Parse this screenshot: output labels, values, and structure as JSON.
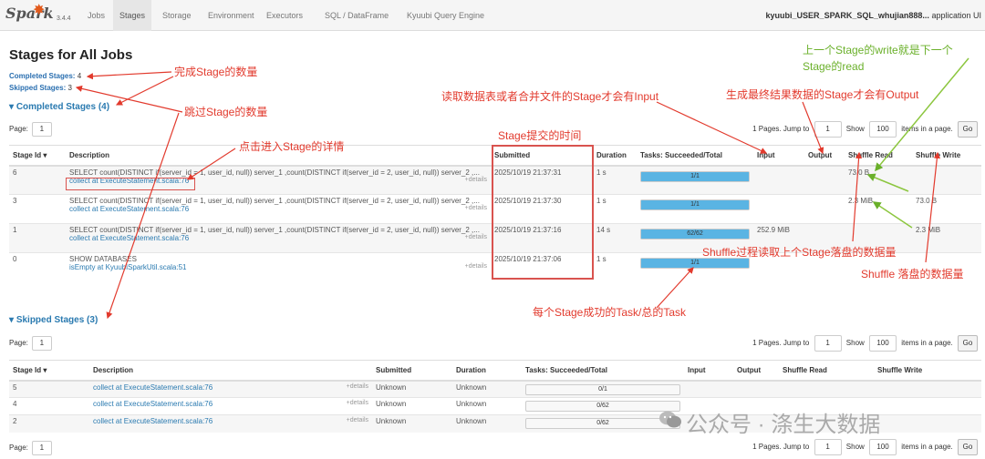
{
  "nav": {
    "logo": "Spark",
    "version": "3.4.4",
    "tabs": [
      "Jobs",
      "Stages",
      "Storage",
      "Environment",
      "Executors",
      "SQL / DataFrame",
      "Kyuubi Query Engine"
    ],
    "active_tab": "Stages",
    "app_name": "kyuubi_USER_SPARK_SQL_whujian888...",
    "app_suffix": "application UI"
  },
  "page_title": "Stages for All Jobs",
  "summary": {
    "completed_label": "Completed Stages:",
    "completed_count": "4",
    "skipped_label": "Skipped Stages:",
    "skipped_count": "3"
  },
  "completed_section": {
    "title": "Completed Stages (4)",
    "page_label": "Page:",
    "page_value": "1",
    "pager": {
      "pages_text": "1 Pages. Jump to",
      "jump_value": "1",
      "show_label": "Show",
      "show_value": "100",
      "items_text": "items in a page.",
      "go": "Go"
    },
    "columns": [
      "Stage Id ▾",
      "Description",
      "Submitted",
      "Duration",
      "Tasks: Succeeded/Total",
      "Input",
      "Output",
      "Shuffle Read",
      "Shuffle Write"
    ],
    "rows": [
      {
        "id": "6",
        "desc": "SELECT count(DISTINCT if(server_id = 1, user_id, null)) server_1 ,count(DISTINCT if(server_id = 2, user_id, null)) server_2 ,...",
        "link": "collect at ExecuteStatement.scala:76",
        "details": "+details",
        "submitted": "2025/10/19 21:37:31",
        "duration": "1 s",
        "tasks": "1/1",
        "progress": 1.0,
        "input": "",
        "output": "",
        "shuffle_read": "73.0 B",
        "shuffle_write": ""
      },
      {
        "id": "3",
        "desc": "SELECT count(DISTINCT if(server_id = 1, user_id, null)) server_1 ,count(DISTINCT if(server_id = 2, user_id, null)) server_2 ,...",
        "link": "collect at ExecuteStatement.scala:76",
        "details": "+details",
        "submitted": "2025/10/19 21:37:30",
        "duration": "1 s",
        "tasks": "1/1",
        "progress": 1.0,
        "input": "",
        "output": "",
        "shuffle_read": "2.3 MiB",
        "shuffle_write": "73.0 B"
      },
      {
        "id": "1",
        "desc": "SELECT count(DISTINCT if(server_id = 1, user_id, null)) server_1 ,count(DISTINCT if(server_id = 2, user_id, null)) server_2 ,...",
        "link": "collect at ExecuteStatement.scala:76",
        "details": "+details",
        "submitted": "2025/10/19 21:37:16",
        "duration": "14 s",
        "tasks": "62/62",
        "progress": 1.0,
        "input": "252.9 MiB",
        "output": "",
        "shuffle_read": "",
        "shuffle_write": "2.3 MiB"
      },
      {
        "id": "0",
        "desc": "SHOW DATABASES",
        "link": "isEmpty at KyuubiSparkUtil.scala:51",
        "details": "+details",
        "submitted": "2025/10/19 21:37:06",
        "duration": "1 s",
        "tasks": "1/1",
        "progress": 1.0,
        "input": "",
        "output": "",
        "shuffle_read": "",
        "shuffle_write": ""
      }
    ]
  },
  "skipped_section": {
    "title": "Skipped Stages (3)",
    "page_label": "Page:",
    "page_value": "1",
    "pager": {
      "pages_text": "1 Pages. Jump to",
      "jump_value": "1",
      "show_label": "Show",
      "show_value": "100",
      "items_text": "items in a page.",
      "go": "Go"
    },
    "columns": [
      "Stage Id ▾",
      "Description",
      "Submitted",
      "Duration",
      "Tasks: Succeeded/Total",
      "Input",
      "Output",
      "Shuffle Read",
      "Shuffle Write"
    ],
    "rows": [
      {
        "id": "5",
        "link": "collect at ExecuteStatement.scala:76",
        "details": "+details",
        "submitted": "Unknown",
        "duration": "Unknown",
        "tasks": "0/1"
      },
      {
        "id": "4",
        "link": "collect at ExecuteStatement.scala:76",
        "details": "+details",
        "submitted": "Unknown",
        "duration": "Unknown",
        "tasks": "0/62"
      },
      {
        "id": "2",
        "link": "collect at ExecuteStatement.scala:76",
        "details": "+details",
        "submitted": "Unknown",
        "duration": "Unknown",
        "tasks": "0/62"
      }
    ]
  },
  "bottom_pager": {
    "page_label": "Page:",
    "page_value": "1"
  },
  "annotations": {
    "completed_count": "完成Stage的数量",
    "skipped_count": "跳过Stage的数量",
    "stage_details": "点击进入Stage的详情",
    "submit_time": "Stage提交的时间",
    "input_note": "读取数据表或者合并文件的Stage才会有Input",
    "output_note": "生成最终结果数据的Stage才会有Output",
    "write_read_1": "上一个Stage的write就是下一个",
    "write_read_2": "Stage的read",
    "shuffle_read_note": "Shuffle过程读取上个Stage落盘的数据量",
    "shuffle_write_note": "Shuffle 落盘的数据量",
    "task_note": "每个Stage成功的Task/总的Task"
  },
  "watermark": "公众号 · 涤生大数据",
  "colors": {
    "annotation_red": "#e23a2d",
    "annotation_green": "#6ab02a",
    "link_blue": "#2a7ab0",
    "progress_fill": "#5ab4e3"
  }
}
